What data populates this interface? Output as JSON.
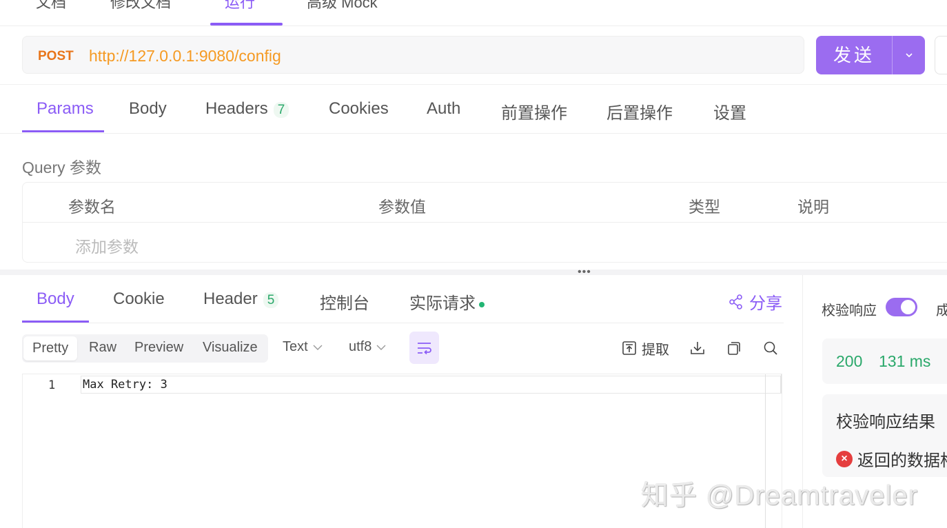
{
  "top_tabs": [
    "文档",
    "修改文档",
    "运行",
    "高级 Mock"
  ],
  "request": {
    "method": "POST",
    "url": "http://127.0.0.1:9080/config",
    "send_label": "发送"
  },
  "req_tabs": {
    "params": "Params",
    "body": "Body",
    "headers": "Headers",
    "headers_count": "7",
    "cookies": "Cookies",
    "auth": "Auth",
    "pre": "前置操作",
    "post": "后置操作",
    "settings": "设置"
  },
  "query": {
    "label": "Query 参数",
    "columns": [
      "参数名",
      "参数值",
      "类型",
      "说明"
    ],
    "add_placeholder": "添加参数"
  },
  "resp_tabs": {
    "body": "Body",
    "cookie": "Cookie",
    "header": "Header",
    "header_count": "5",
    "console": "控制台",
    "actual": "实际请求",
    "share": "分享"
  },
  "toolbar": {
    "modes": [
      "Pretty",
      "Raw",
      "Preview",
      "Visualize"
    ],
    "format": "Text",
    "encoding": "utf8",
    "extract": "提取"
  },
  "editor": {
    "line": "1",
    "code": "Max Retry: 3"
  },
  "right_panel": {
    "verify_label": "校验响应",
    "cut_text": "成",
    "status_code": "200",
    "time": "131 ms",
    "result_title": "校验响应结果",
    "result_error": "返回的数据格"
  },
  "watermark": "知乎 @Dreamtraveler",
  "colors": {
    "accent": "#8b5cf6",
    "method": "#e8751a",
    "url": "#f59a23",
    "success": "#2aa86a",
    "error": "#e53e3e"
  }
}
